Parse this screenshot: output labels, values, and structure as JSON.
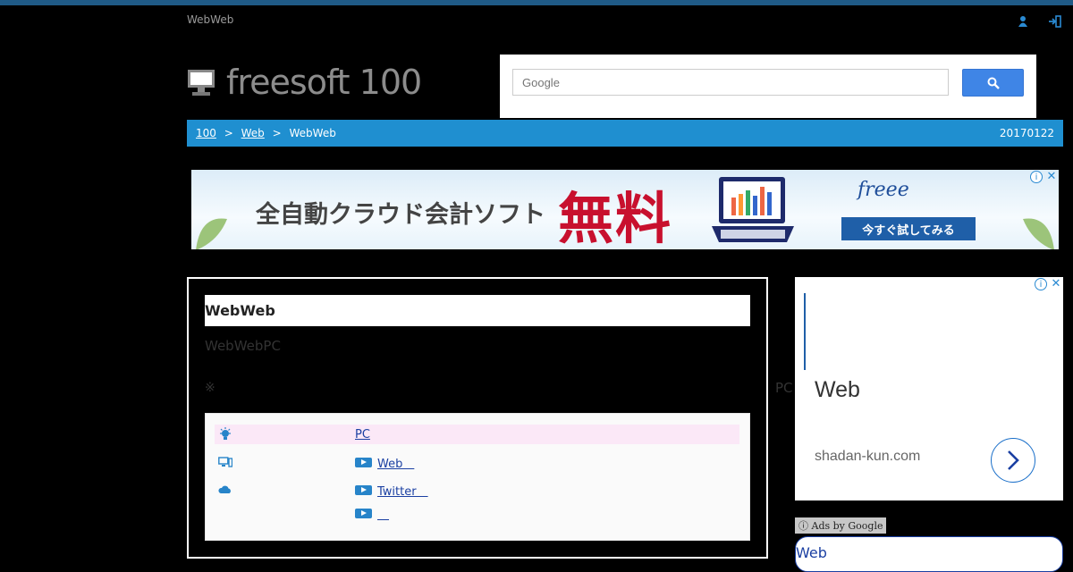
{
  "header": {
    "site_tag": "WebWeb",
    "logo_text": "freesoft 100",
    "icons": [
      "user-icon",
      "login-icon"
    ]
  },
  "search": {
    "placeholder": "Google"
  },
  "breadcrumb": {
    "home": "100",
    "sep1": ">",
    "category": "Web",
    "sep2": ">",
    "current": "WebWeb",
    "date": "20170122"
  },
  "banner_ad": {
    "text": "全自動クラウド会計ソフト",
    "free": "無料",
    "brand": "freee",
    "cta": "今すぐ試してみる"
  },
  "article": {
    "title": "WebWeb",
    "description": "WebWebPC",
    "note": "※",
    "note_right": "PC",
    "rows": [
      {
        "icon": "lightbulb-icon",
        "link": "PC"
      },
      {
        "icon": "devices-icon",
        "link": "Web　"
      },
      {
        "icon": "cloud-icon",
        "link": "Twitter　 "
      },
      {
        "icon": "",
        "link": "　"
      }
    ]
  },
  "side_ad": {
    "headline": "Web",
    "domain": "shadan-kun.com",
    "ads_by": "Ads by Google",
    "link": "Web"
  },
  "colors": {
    "accent": "#1f8fd0",
    "search_button": "#3f85e6",
    "link": "#1a3fa2"
  }
}
